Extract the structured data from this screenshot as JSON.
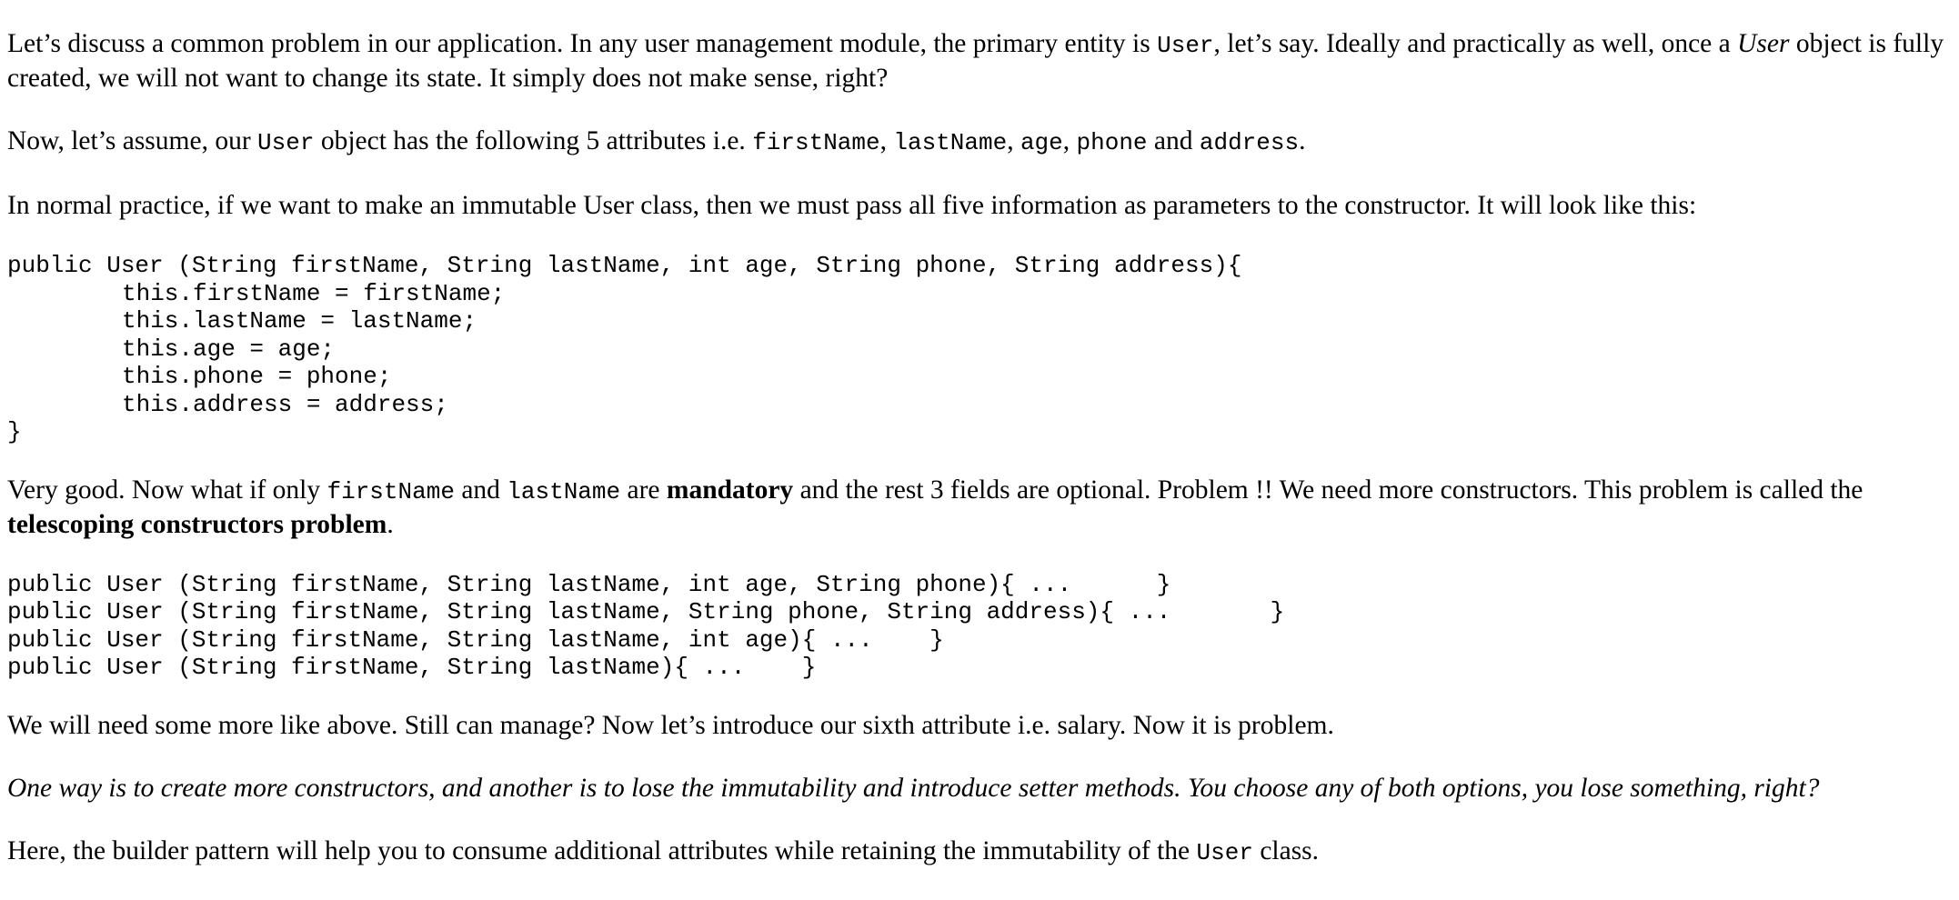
{
  "p1": {
    "t1": "Let’s discuss a common problem in our application. In any user management module, the primary entity is ",
    "c1": "User",
    "t2": ", let’s say. Ideally and practically as well, once a ",
    "e1": "User",
    "t3": " object is fully created, we will not want to change its state. It simply does not make sense, right?"
  },
  "p2": {
    "t1": "Now, let’s assume, our ",
    "c1": "User",
    "t2": " object has the following 5 attributes i.e. ",
    "c2": "firstName",
    "s1": ", ",
    "c3": "lastName",
    "s2": ", ",
    "c4": "age",
    "s3": ", ",
    "c5": "phone",
    "t3": " and ",
    "c6": "address",
    "t4": "."
  },
  "p3": {
    "text": "In normal practice, if we want to make an immutable User class, then we must pass all five information as parameters to the constructor. It will look like this:"
  },
  "code1": {
    "l1": "public User (String firstName, String lastName, int age, String phone, String address){",
    "l2": "this.firstName = firstName;",
    "l3": "this.lastName = lastName;",
    "l4": "this.age = age;",
    "l5": "this.phone = phone;",
    "l6": "this.address = address;",
    "l7": "}"
  },
  "p4": {
    "t1": "Very good. Now what if only ",
    "c1": "firstName",
    "t2": " and ",
    "c2": "lastName",
    "t3": " are ",
    "b1": "mandatory",
    "t4": " and the rest 3 fields are optional. Problem !! We need more constructors. This problem is called the ",
    "b2": "telescoping constructors problem",
    "t5": "."
  },
  "code2": {
    "l1": "public User (String firstName, String lastName, int age, String phone){ ...      }",
    "l2": "public User (String firstName, String lastName, String phone, String address){ ...       }",
    "l3": "public User (String firstName, String lastName, int age){ ...    }",
    "l4": "public User (String firstName, String lastName){ ...    }"
  },
  "p5": {
    "text": "We will need some more like above. Still can manage? Now let’s introduce our sixth attribute i.e. salary. Now it is problem."
  },
  "p6": {
    "text": "One way is to create more constructors, and another is to lose the immutability and introduce setter methods. You choose any of both options, you lose something, right?"
  },
  "p7": {
    "t1": "Here, the builder pattern will help you to consume additional attributes while retaining the immutability of the ",
    "c1": "User",
    "t2": " class."
  }
}
